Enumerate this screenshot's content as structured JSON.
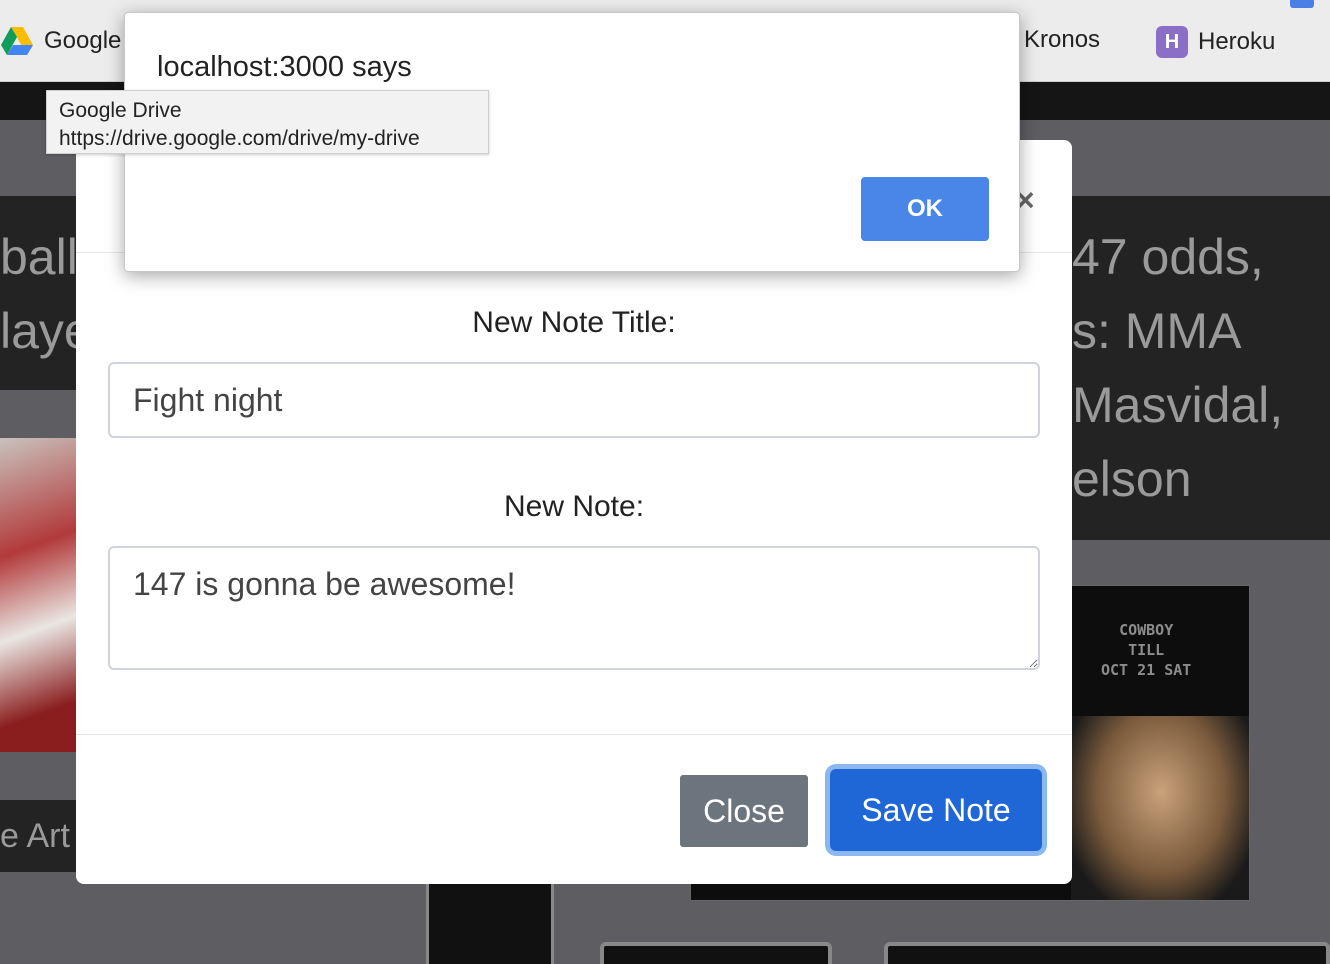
{
  "bookmarks": {
    "google_drive": "Google",
    "kronos": "Kronos",
    "heroku": "Heroku"
  },
  "tooltip": {
    "title": "Google Drive",
    "url": "https://drive.google.com/drive/my-drive"
  },
  "alert": {
    "title": "localhost:3000 says",
    "ok_label": "OK"
  },
  "backdrop": {
    "left_lines": [
      "ball'",
      "laye"
    ],
    "right_lines": [
      "47 odds,",
      "s: MMA",
      " Masvidal,",
      "elson"
    ],
    "art_label": "e Art",
    "poster_lines": [
      "COWBOY",
      "TILL",
      "OCT 21 SAT"
    ]
  },
  "modal": {
    "close_glyph": "×",
    "title_label": "New Note Title:",
    "title_value": "Fight night",
    "note_label": "New Note:",
    "note_value": "147 is gonna be awesome!",
    "close_button": "Close",
    "save_button": "Save Note"
  },
  "colors": {
    "primary": "#1f67d6",
    "secondary": "#6c757d",
    "alert_ok": "#4a86e8"
  }
}
